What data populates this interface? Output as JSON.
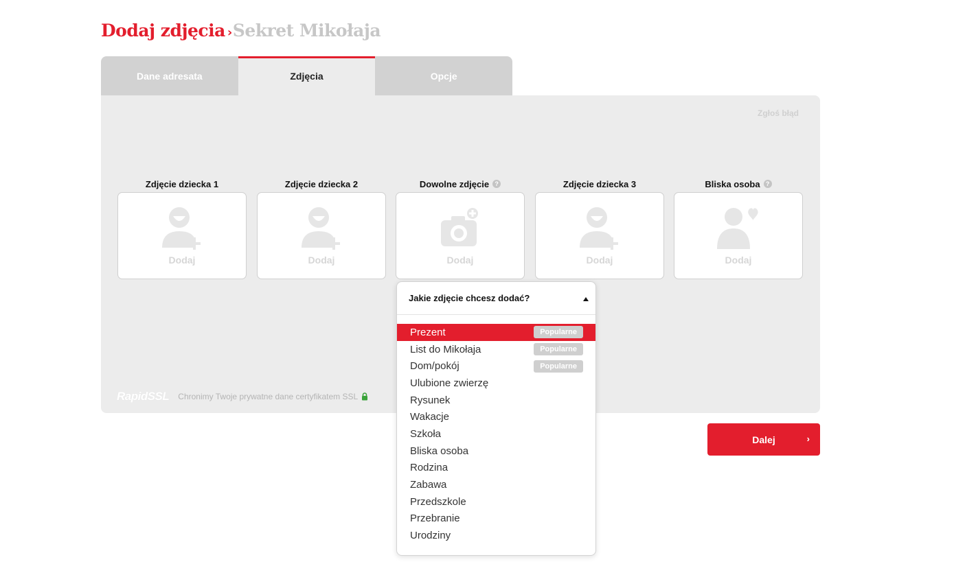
{
  "header": {
    "title": "Dodaj zdjęcia",
    "separator": "›",
    "subtitle": "Sekret Mikołaja"
  },
  "tabs": [
    {
      "label": "Dane adresata",
      "active": false
    },
    {
      "label": "Zdjęcia",
      "active": true
    },
    {
      "label": "Opcje",
      "active": false
    }
  ],
  "panel": {
    "report_link": "Zgłoś błąd",
    "slots": [
      {
        "title": "Zdjęcie dziecka 1",
        "add_label": "Dodaj",
        "icon": "child-add-icon",
        "help": false
      },
      {
        "title": "Zdjęcie dziecka 2",
        "add_label": "Dodaj",
        "icon": "child-add-icon",
        "help": false
      },
      {
        "title": "Dowolne zdjęcie",
        "add_label": "Dodaj",
        "icon": "camera-add-icon",
        "help": true
      },
      {
        "title": "Zdjęcie dziecka 3",
        "add_label": "Dodaj",
        "icon": "child-add-icon",
        "help": false
      },
      {
        "title": "Bliska osoba",
        "add_label": "Dodaj",
        "icon": "person-heart-icon",
        "help": true
      }
    ],
    "help_glyph": "?",
    "ssl": {
      "logo": "RapidSSL",
      "text": "Chronimy Twoje prywatne dane certyfikatem SSL"
    }
  },
  "dropdown": {
    "question": "Jakie zdjęcie chcesz dodać?",
    "items": [
      {
        "label": "Prezent",
        "badge": "Popularne",
        "selected": true
      },
      {
        "label": "List do Mikołaja",
        "badge": "Popularne",
        "selected": false
      },
      {
        "label": "Dom/pokój",
        "badge": "Popularne",
        "selected": false
      },
      {
        "label": "Ulubione zwierzę",
        "badge": "",
        "selected": false
      },
      {
        "label": "Rysunek",
        "badge": "",
        "selected": false
      },
      {
        "label": "Wakacje",
        "badge": "",
        "selected": false
      },
      {
        "label": "Szkoła",
        "badge": "",
        "selected": false
      },
      {
        "label": "Bliska osoba",
        "badge": "",
        "selected": false
      },
      {
        "label": "Rodzina",
        "badge": "",
        "selected": false
      },
      {
        "label": "Zabawa",
        "badge": "",
        "selected": false
      },
      {
        "label": "Przedszkole",
        "badge": "",
        "selected": false
      },
      {
        "label": "Przebranie",
        "badge": "",
        "selected": false
      },
      {
        "label": "Urodziny",
        "badge": "",
        "selected": false
      }
    ]
  },
  "next_button": {
    "label": "Dalej",
    "chevron": "›"
  },
  "colors": {
    "accent": "#e31e2d",
    "panel_bg": "#ececec",
    "tab_bg": "#d2d2d2",
    "badge_bg": "#cfcfcf",
    "ssl_lock": "#3aa33a"
  }
}
